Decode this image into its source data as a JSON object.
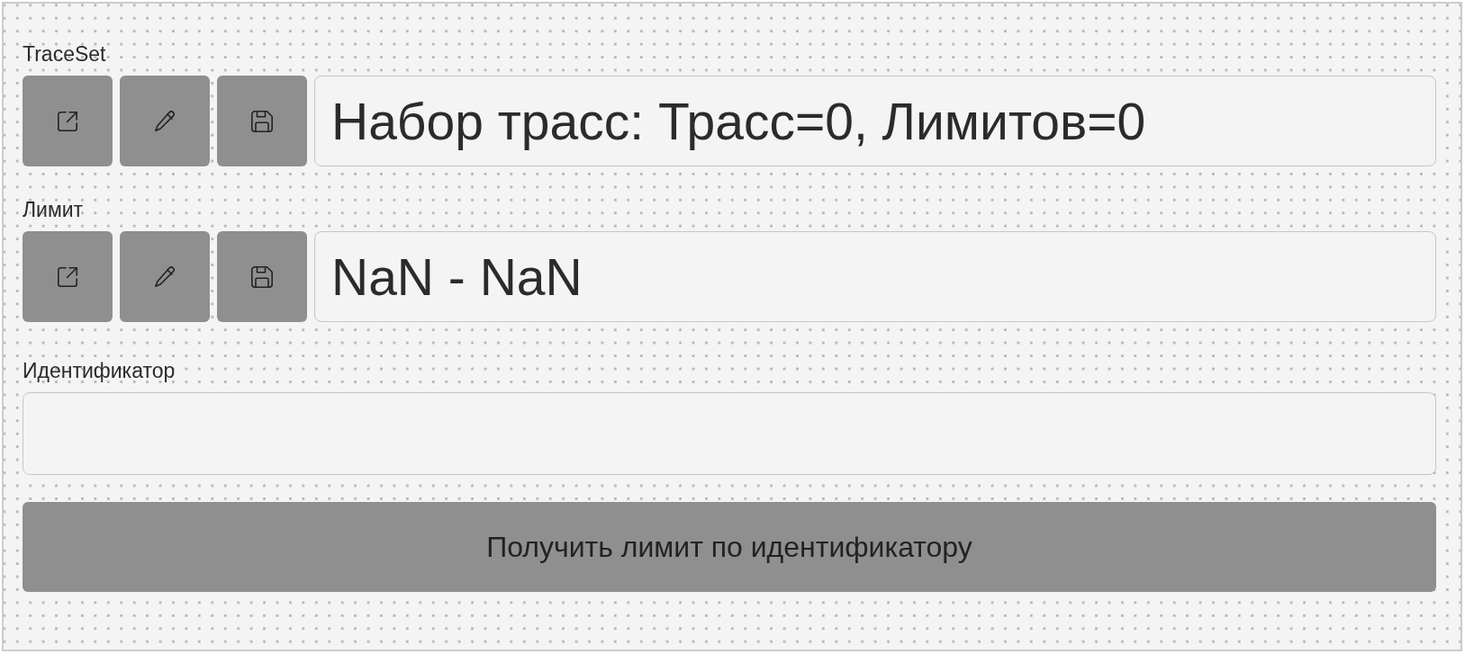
{
  "form": {
    "groups": [
      {
        "kind": "picker",
        "label": "TraceSet",
        "value": "Набор трасс: Трасс=0, Лимитов=0"
      },
      {
        "kind": "picker",
        "label": "Лимит",
        "value": "NaN - NaN"
      },
      {
        "kind": "input",
        "label": "Идентификатор"
      }
    ],
    "action_button": {
      "label": "Получить лимит по идентификатору"
    }
  }
}
